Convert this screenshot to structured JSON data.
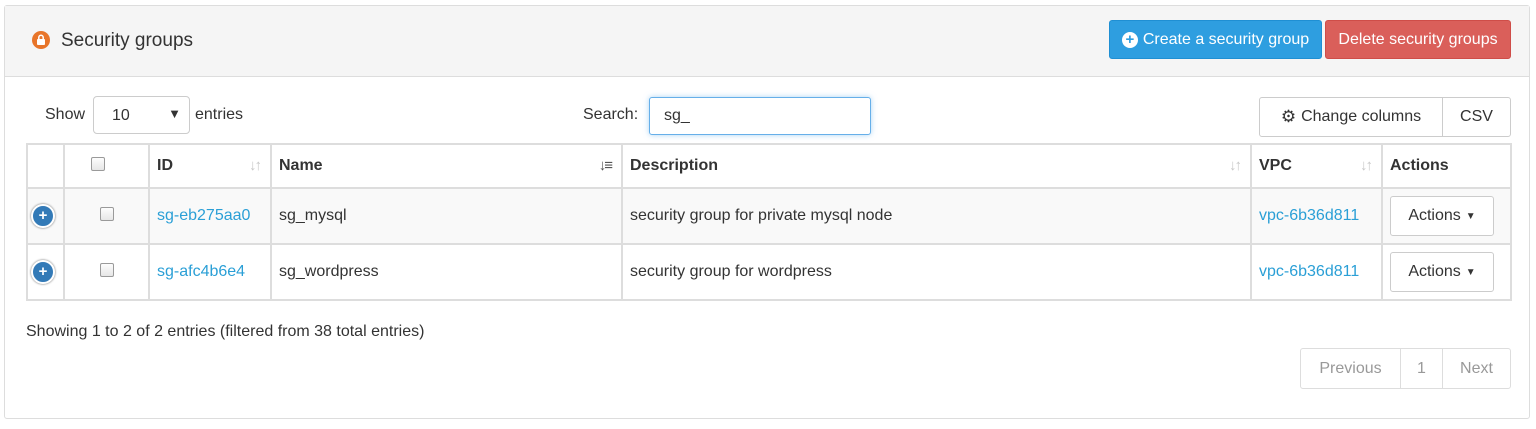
{
  "header": {
    "title": "Security groups",
    "create_label": "Create a security group",
    "delete_label": "Delete security groups"
  },
  "controls": {
    "show_label": "Show",
    "page_size": "10",
    "entries_label": "entries",
    "search_label": "Search:",
    "search_value": "sg_",
    "change_columns_label": "Change columns",
    "csv_label": "CSV"
  },
  "table": {
    "columns": [
      "ID",
      "Name",
      "Description",
      "VPC",
      "Actions"
    ],
    "rows": [
      {
        "id": "sg-eb275aa0",
        "name": "sg_mysql",
        "description": "security group for private mysql node",
        "vpc": "vpc-6b36d811",
        "action": "Actions"
      },
      {
        "id": "sg-afc4b6e4",
        "name": "sg_wordpress",
        "description": "security group for wordpress",
        "vpc": "vpc-6b36d811",
        "action": "Actions"
      }
    ]
  },
  "footer": {
    "info": "Showing 1 to 2 of 2 entries (filtered from 38 total entries)",
    "previous_label": "Previous",
    "page": "1",
    "next_label": "Next"
  },
  "colors": {
    "primary": "#2e9ee0",
    "danger": "#da5f5a",
    "link": "#2a9fd6",
    "lock_badge": "#e8752a"
  }
}
